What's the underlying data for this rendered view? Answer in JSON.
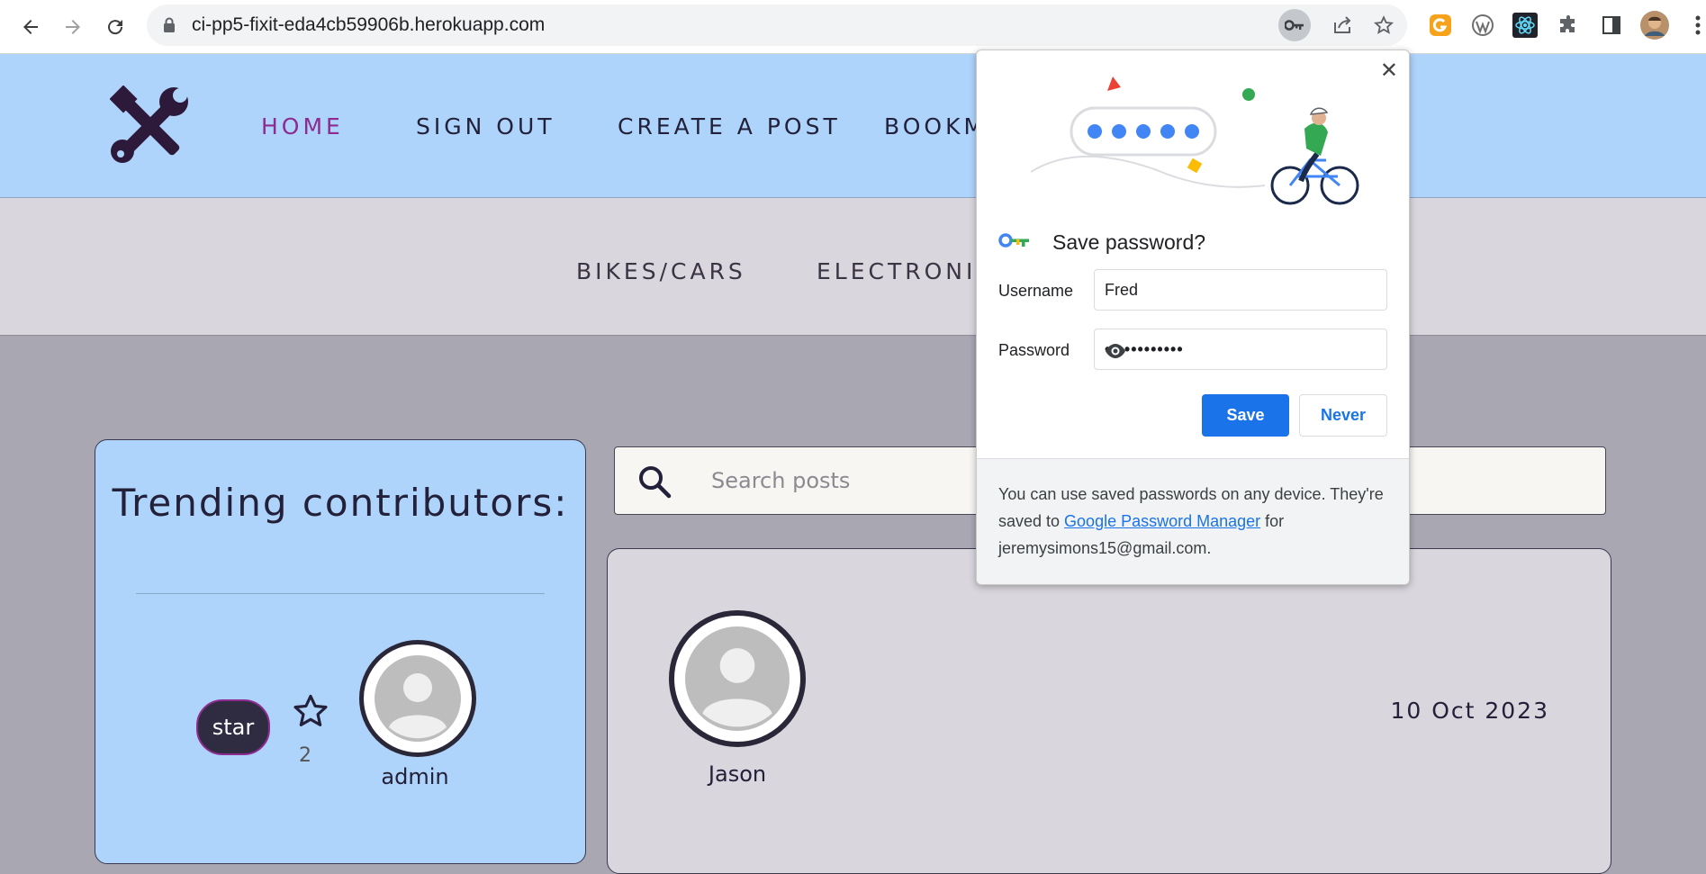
{
  "browser": {
    "url": "ci-pp5-fixit-eda4cb59906b.herokuapp.com"
  },
  "nav": {
    "items": [
      "HOME",
      "SIGN OUT",
      "CREATE A POST",
      "BOOKM..."
    ]
  },
  "categories": {
    "items": [
      "BIKES/CARS",
      "ELECTRONIC..."
    ]
  },
  "trending": {
    "title": "Trending contributors:",
    "star_label": "star",
    "star_count": "2",
    "user": "admin"
  },
  "search": {
    "placeholder": "Search posts"
  },
  "post": {
    "author": "Jason",
    "date": "10 Oct 2023"
  },
  "password_popup": {
    "title": "Save password?",
    "username_label": "Username",
    "username_value": "Fred",
    "password_label": "Password",
    "password_value": "••••••••••••",
    "save_label": "Save",
    "never_label": "Never",
    "footer_pre": "You can use saved passwords on any device. They're saved to ",
    "footer_link": "Google Password Manager",
    "footer_post": " for jeremysimons15@gmail.com."
  },
  "colors": {
    "header_bg": "#afd4fb",
    "nav_active": "#8e2b8f",
    "page_bg": "#a9a7b2",
    "primary_button": "#1a73e8"
  }
}
